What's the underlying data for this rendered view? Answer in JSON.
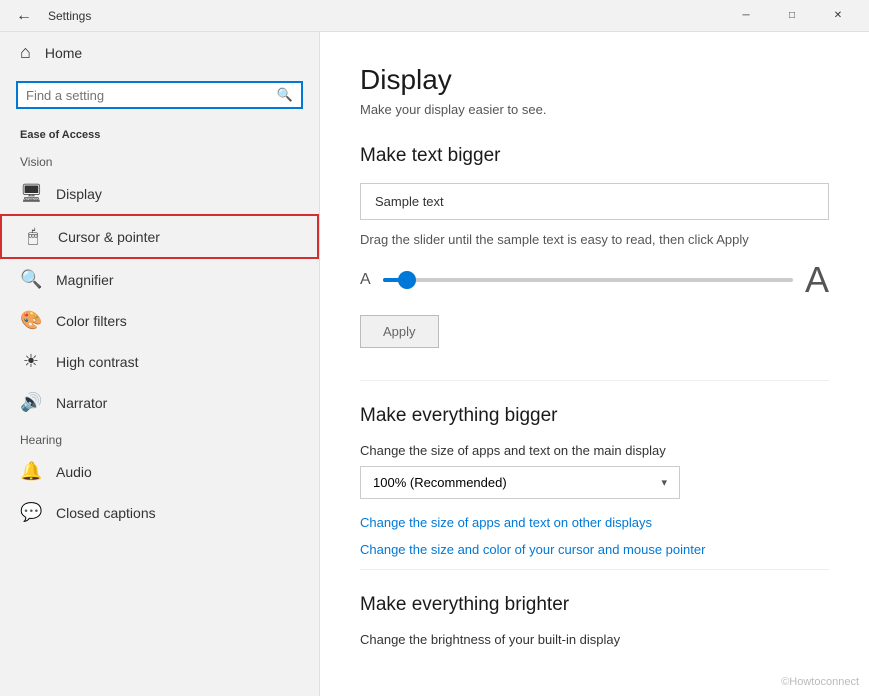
{
  "titlebar": {
    "title": "Settings",
    "back_label": "←",
    "minimize": "─",
    "restore": "□",
    "close": "✕"
  },
  "sidebar": {
    "home_label": "Home",
    "search_placeholder": "Find a setting",
    "ease_of_access_label": "Ease of Access",
    "vision_label": "Vision",
    "items": [
      {
        "id": "display",
        "label": "Display",
        "icon": "🖥"
      },
      {
        "id": "cursor-pointer",
        "label": "Cursor & pointer",
        "icon": "🖱",
        "highlighted": true
      },
      {
        "id": "magnifier",
        "label": "Magnifier",
        "icon": "🔍"
      },
      {
        "id": "color-filters",
        "label": "Color filters",
        "icon": "🌀"
      },
      {
        "id": "high-contrast",
        "label": "High contrast",
        "icon": "☀"
      },
      {
        "id": "narrator",
        "label": "Narrator",
        "icon": "🔊"
      }
    ],
    "hearing_label": "Hearing",
    "hearing_items": [
      {
        "id": "audio",
        "label": "Audio",
        "icon": "🔔"
      },
      {
        "id": "closed-captions",
        "label": "Closed captions",
        "icon": "💬"
      }
    ]
  },
  "content": {
    "page_title": "Display",
    "page_subtitle": "Make your display easier to see.",
    "section_make_text_bigger": "Make text bigger",
    "sample_text": "Sample text",
    "slider_description": "Drag the slider until the sample text is easy to read, then click Apply",
    "slider_small_label": "A",
    "slider_large_label": "A",
    "apply_label": "Apply",
    "section_make_everything_bigger": "Make everything bigger",
    "dropdown_label": "Change the size of apps and text on the main display",
    "dropdown_value": "100% (Recommended)",
    "link1": "Change the size of apps and text on other displays",
    "link2": "Change the size and color of your cursor and mouse pointer",
    "section_make_everything_brighter": "Make everything brighter",
    "brighter_description": "Change the brightness of your built-in display"
  },
  "watermark": "©Howtoconnect"
}
